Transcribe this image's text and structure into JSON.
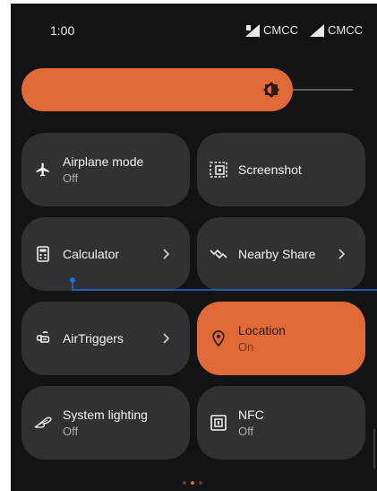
{
  "status_bar": {
    "time": "1:00",
    "carriers": [
      "CMCC",
      "CMCC"
    ]
  },
  "brightness": {
    "level_percent": 82,
    "accent_color": "#e06a37"
  },
  "tiles": [
    {
      "label": "Airplane mode",
      "secondary": "Off",
      "icon": "airplane-icon",
      "active": false,
      "has_chevron": false
    },
    {
      "label": "Screenshot",
      "secondary": "",
      "icon": "screenshot-icon",
      "active": false,
      "has_chevron": false
    },
    {
      "label": "Calculator",
      "secondary": "",
      "icon": "calculator-icon",
      "active": false,
      "has_chevron": true
    },
    {
      "label": "Nearby Share",
      "secondary": "",
      "icon": "nearby-share-icon",
      "active": false,
      "has_chevron": true
    },
    {
      "label": "AirTriggers",
      "secondary": "",
      "icon": "airtriggers-icon",
      "active": false,
      "has_chevron": true
    },
    {
      "label": "Location",
      "secondary": "On",
      "icon": "location-pin-icon",
      "active": true,
      "has_chevron": false
    },
    {
      "label": "System lighting",
      "secondary": "Off",
      "icon": "rog-logo-icon",
      "active": false,
      "has_chevron": false
    },
    {
      "label": "NFC",
      "secondary": "Off",
      "icon": "nfc-icon",
      "active": false,
      "has_chevron": false
    }
  ],
  "pager": {
    "page_count": 3,
    "current_page": 2
  },
  "colors": {
    "background": "#121315",
    "tile": "#2e3235",
    "tile_active": "#e06a37",
    "connector": "#1f6fd6"
  }
}
